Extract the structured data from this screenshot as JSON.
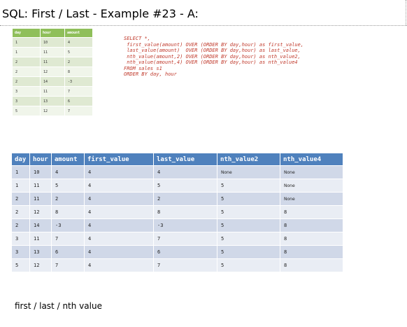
{
  "title": "SQL: First / Last - Example #23 - A:",
  "source_table": {
    "headers": [
      "day",
      "hour",
      "amount"
    ],
    "rows": [
      [
        "1",
        "10",
        "4"
      ],
      [
        "1",
        "11",
        "5"
      ],
      [
        "2",
        "11",
        "2"
      ],
      [
        "2",
        "12",
        "8"
      ],
      [
        "2",
        "14",
        "-3"
      ],
      [
        "3",
        "11",
        "7"
      ],
      [
        "3",
        "13",
        "6"
      ],
      [
        "5",
        "12",
        "7"
      ]
    ]
  },
  "sql_lines": [
    "SELECT *,",
    " first_value(amount) OVER (ORDER BY day,hour) as first_value,",
    " last_value(amount)  OVER (ORDER BY day,hour) as last_value,",
    " nth_value(amount,2) OVER (ORDER BY day,hour) as nth_value2,",
    " nth_value(amount,4) OVER (ORDER BY day,hour) as nth_value4",
    "FROM sales s1",
    "ORDER BY day, hour"
  ],
  "result_table": {
    "headers": [
      "day",
      "hour",
      "amount",
      "first_value",
      "last_value",
      "nth_value2",
      "nth_value4"
    ],
    "rows": [
      [
        "1",
        "10",
        "4",
        "4",
        "4",
        "None",
        "None"
      ],
      [
        "1",
        "11",
        "5",
        "4",
        "5",
        "5",
        "None"
      ],
      [
        "2",
        "11",
        "2",
        "4",
        "2",
        "5",
        "None"
      ],
      [
        "2",
        "12",
        "8",
        "4",
        "8",
        "5",
        "8"
      ],
      [
        "2",
        "14",
        "-3",
        "4",
        "-3",
        "5",
        "8"
      ],
      [
        "3",
        "11",
        "7",
        "4",
        "7",
        "5",
        "8"
      ],
      [
        "3",
        "13",
        "6",
        "4",
        "6",
        "5",
        "8"
      ],
      [
        "5",
        "12",
        "7",
        "4",
        "7",
        "5",
        "8"
      ]
    ]
  },
  "footer": "first / last / nth value",
  "colors": {
    "source_header": "#8fbf5a",
    "result_header": "#4f81bd",
    "sql_text": "#c0392b"
  }
}
